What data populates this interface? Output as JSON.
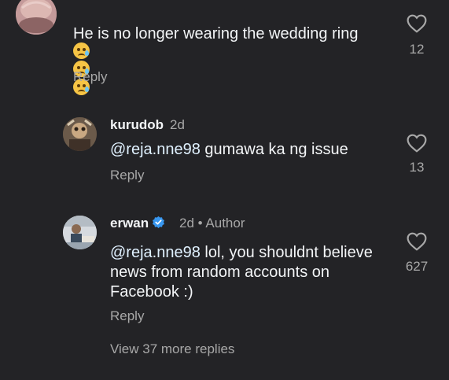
{
  "comments": [
    {
      "text": "He is no longer wearing the wedding ring",
      "emojis": [
        "crying-face",
        "crying-face",
        "crying-face"
      ],
      "reply_label": "Reply",
      "likes": "12"
    },
    {
      "username": "kurudob",
      "time": "2d",
      "mention": "@reja.nne98",
      "text": " gumawa ka ng issue",
      "reply_label": "Reply",
      "likes": "13"
    },
    {
      "username": "erwan",
      "time": "2d",
      "separator": "•",
      "author_label": "Author",
      "mention": "@reja.nne98",
      "text_line1": " lol, you shouldnt believe",
      "text_line2": "news from random accounts on",
      "text_line3": "Facebook :)",
      "reply_label": "Reply",
      "likes": "627"
    }
  ],
  "view_more_label": "View 37 more replies",
  "colors": {
    "background": "#232326",
    "text": "#f3f5f7",
    "secondary": "#a8a8a8",
    "mention": "#e0f1ff",
    "verified": "#3897f0"
  }
}
